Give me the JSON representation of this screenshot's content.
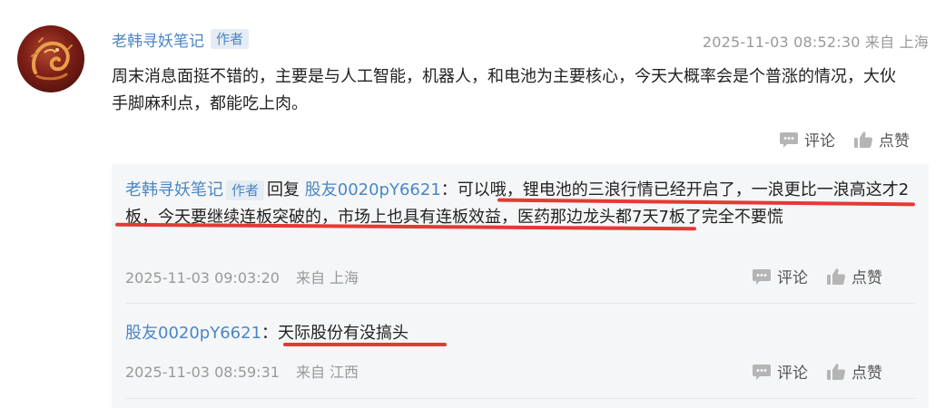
{
  "comment": {
    "author": "老韩寻妖笔记",
    "badge": "作者",
    "timestamp": "2025-11-03 08:52:30",
    "location": "来自 上海",
    "content": "周末消息面挺不错的，主要是与人工智能，机器人，和电池为主要核心，今天大概率会是个普涨的情况，大伙手脚麻利点，都能吃上肉。",
    "comment_label": "评论",
    "like_label": "点赞"
  },
  "replies": [
    {
      "author": "老韩寻妖笔记",
      "badge": "作者",
      "reply_word": "回复",
      "reply_to": "股友0020pY6621",
      "separator": "：",
      "text": "可以哦，锂电池的三浪行情已经开启了，一浪更比一浪高这才2板，今天要继续连板突破的，市场上也具有连板效益，医药那边龙头都7天7板了完全不要慌",
      "timestamp": "2025-11-03 09:03:20",
      "location": "来自 上海",
      "comment_label": "评论",
      "like_label": "点赞"
    },
    {
      "author": "股友0020pY6621",
      "separator": "：",
      "text": "天际股份有没搞头",
      "timestamp": "2025-11-03 08:59:31",
      "location": "来自 江西",
      "comment_label": "评论",
      "like_label": "点赞"
    }
  ],
  "colors": {
    "link_blue": "#4a86c6",
    "annotation_red": "#e53935",
    "reply_bg": "#f5f6f7",
    "meta_gray": "#999999"
  },
  "icons": [
    "comment-icon",
    "like-icon"
  ]
}
